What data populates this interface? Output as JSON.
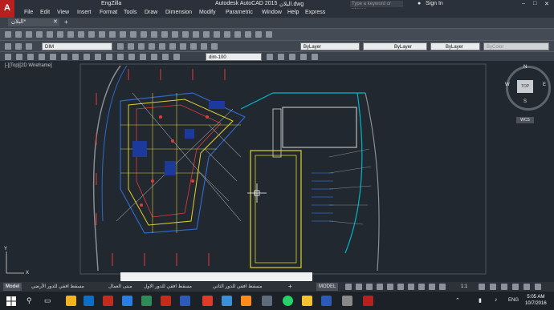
{
  "title_bar": {
    "app_name": "EngZilla",
    "product": "Autodesk AutoCAD 2015",
    "file": "البلان.dwg",
    "search_placeholder": "Type a keyword or phrase",
    "sign_in": "Sign In"
  },
  "menu": [
    "File",
    "Edit",
    "View",
    "Insert",
    "Format",
    "Tools",
    "Draw",
    "Dimension",
    "Modify",
    "Parametric",
    "Window",
    "Help",
    "Express"
  ],
  "ribbon": {
    "file_tab": "البلان*",
    "layer_combo": "DIM",
    "dim_style": "dim-100",
    "color_combo": "ByLayer",
    "linetype_combo": "ByLayer",
    "lineweight_combo": "ByLayer",
    "plotstyle_combo": "ByColor"
  },
  "viewport": {
    "label": "[-][Top][2D Wireframe]",
    "viewcube": {
      "face": "TOP",
      "n": "N",
      "e": "E",
      "s": "S",
      "w": "W",
      "wcs": "WCS"
    },
    "ucs": {
      "x": "X",
      "y": "Y"
    }
  },
  "layout_tabs": [
    "Model",
    "مسقط افقي للدور الأرضي",
    "مبنى العمال",
    "مسقط افقي للدور الاول",
    "مسقط افقي للدور الثاني"
  ],
  "status": {
    "model": "MODEL",
    "scale": "1:1"
  },
  "taskbar": {
    "lang": "ENG",
    "time": "5:05 AM",
    "date": "10/7/2016"
  },
  "colors": {
    "accent": "#b8201f",
    "canvas": "#212830",
    "ribbon": "#3a414b"
  }
}
